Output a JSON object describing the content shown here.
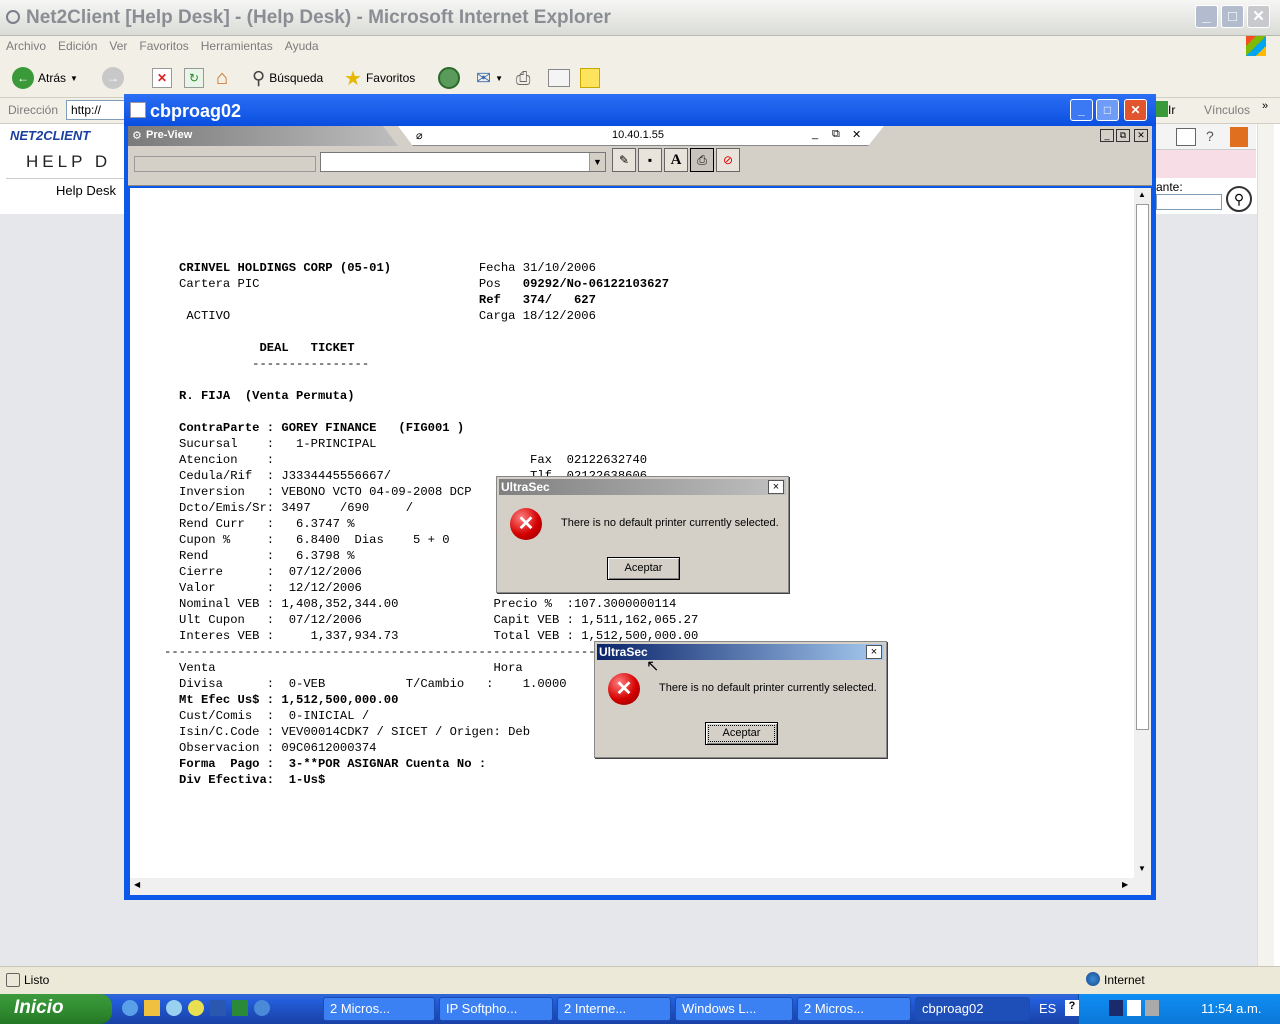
{
  "ie": {
    "title": "Net2Client [Help Desk] - (Help Desk) - Microsoft Internet Explorer",
    "menu": [
      "Archivo",
      "Edición",
      "Ver",
      "Favoritos",
      "Herramientas",
      "Ayuda"
    ],
    "back_label": "Atrás",
    "search_label": "Búsqueda",
    "favorites_label": "Favoritos",
    "address_label": "Dirección",
    "address_value": "http://",
    "go_label": "Ir",
    "links_label": "Vínculos",
    "help_desk_label": "Help Desk",
    "logo_line1": "NET2CLIENT",
    "logo_line2": "HELP D",
    "ante_label": "ante:",
    "status_text": "Listo",
    "zone_text": "Internet"
  },
  "cbproag": {
    "title": "cbproag02",
    "preview_label": "Pre-View",
    "ip": "10.40.1.55"
  },
  "doc": {
    "lines": [
      {
        "t": "CRINVEL HOLDINGS CORP (05-01)            Fecha 31/10/2006",
        "bold_prefix": "CRINVEL HOLDINGS CORP (05-01)"
      },
      {
        "t": "Cartera PIC                              Pos   09292/No-06122103627",
        "bold_suffix": "09292/No-06122103627"
      },
      {
        "t": "                                         Ref   374/   627",
        "bold_suffix": "Ref   374/   627"
      },
      {
        "t": " ACTIVO                                  Carga 18/12/2006"
      },
      {
        "t": ""
      },
      {
        "t": "           DEAL   TICKET",
        "bold": true
      },
      {
        "t": "          ----------------"
      },
      {
        "t": ""
      },
      {
        "t": "R. FIJA  (Venta Permuta)",
        "bold": true
      },
      {
        "t": ""
      },
      {
        "t": "ContraParte : GOREY FINANCE   (FIG001 )",
        "bold": true
      },
      {
        "t": "Sucursal    :   1-PRINCIPAL"
      },
      {
        "t": "Atencion    :                                   Fax  02122632740"
      },
      {
        "t": "Cedula/Rif  : J3334445556667/                   Tlf  02122638606"
      },
      {
        "t": "Inversion   : VEBONO VCTO 04-09-2008 DCP"
      },
      {
        "t": "Dcto/Emis/Sr: 3497    /690     /"
      },
      {
        "t": "Rend Curr   :   6.3747 %"
      },
      {
        "t": "Cupon %     :   6.8400  Dias    5 + 0"
      },
      {
        "t": "Rend        :   6.3798 %"
      },
      {
        "t": "Cierre      :  07/12/2006"
      },
      {
        "t": "Valor       :  12/12/2006"
      },
      {
        "t": "Nominal VEB : 1,408,352,344.00             Precio %  :107.3000000114"
      },
      {
        "t": "Ult Cupon   :  07/12/2006                  Capit VEB : 1,511,162,065.27"
      },
      {
        "t": "Interes VEB :     1,337,934.73             Total VEB : 1,512,500,000.00"
      },
      {
        "t": "--------------------------------------------------------------------------"
      },
      {
        "t": "Venta                                      Hora"
      },
      {
        "t": "Divisa      :  0-VEB           T/Cambio   :    1.0000"
      },
      {
        "t": "Mt Efec Us$ : 1,512,500,000.00",
        "bold": true
      },
      {
        "t": "Cust/Comis  :  0-INICIAL /"
      },
      {
        "t": "Isin/C.Code : VEV00014CDK7 / SICET / Origen: Deb"
      },
      {
        "t": "Observacion : 09C0612000374"
      },
      {
        "t": "Forma  Pago :  3-**POR ASIGNAR Cuenta No :",
        "bold": true
      },
      {
        "t": "Div Efectiva:  1-Us$",
        "bold": true
      }
    ]
  },
  "dialog1": {
    "title": "UltraSec",
    "message": "There is no default printer currently selected.",
    "button": "Aceptar",
    "close": "×"
  },
  "dialog2": {
    "title": "UltraSec",
    "message": "There is no default printer currently selected.",
    "button": "Aceptar",
    "close": "×"
  },
  "taskbar": {
    "start_label": "Inicio",
    "tasks": [
      "2 Micros...",
      "IP Softpho...",
      "2 Interne...",
      "Windows L...",
      "2 Micros...",
      "cbproag02"
    ],
    "lang": "ES",
    "clock": "11:54 a.m."
  }
}
